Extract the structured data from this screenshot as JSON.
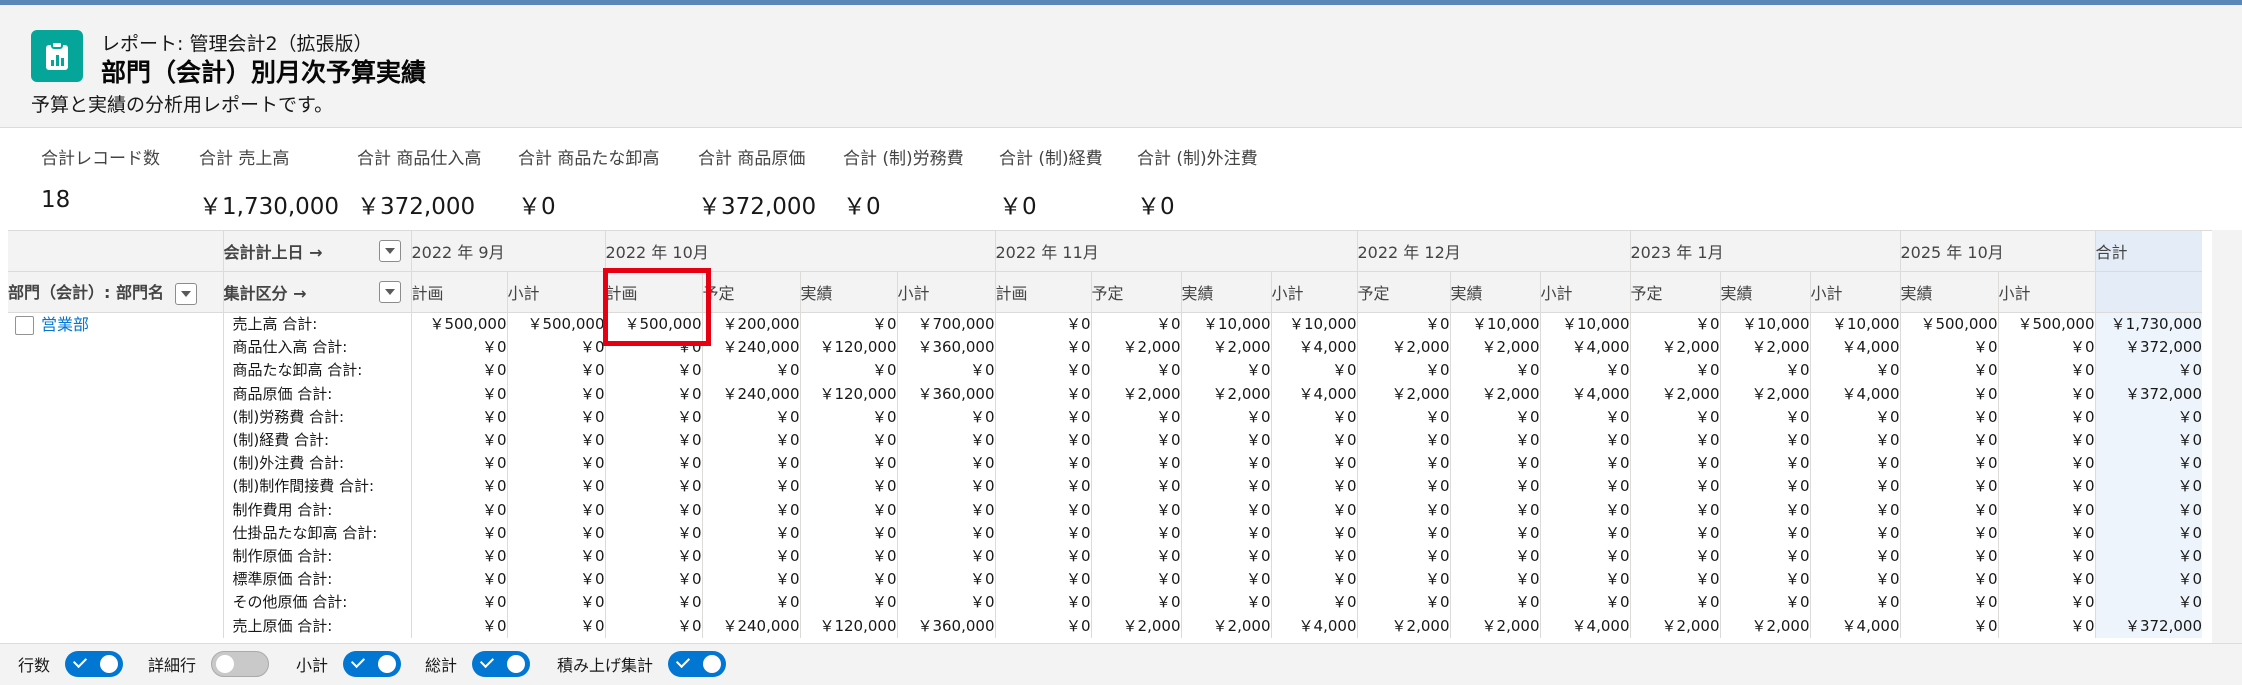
{
  "header": {
    "breadcrumb": "レポート: 管理会計2（拡張版）",
    "title": "部門（会計）別月次予算実績",
    "description": "予算と実績の分析用レポートです。"
  },
  "summary": [
    {
      "label": "合計レコード数",
      "value": "18"
    },
    {
      "label": "合計 売上高",
      "value": "￥1,730,000"
    },
    {
      "label": "合計 商品仕入高",
      "value": "￥372,000"
    },
    {
      "label": "合計 商品たな卸高",
      "value": "￥0"
    },
    {
      "label": "合計 商品原価",
      "value": "￥372,000"
    },
    {
      "label": "合計 (制)労務費",
      "value": "￥0"
    },
    {
      "label": "合計 (制)経費",
      "value": "￥0"
    },
    {
      "label": "合計 (制)外注費",
      "value": "￥0"
    }
  ],
  "table": {
    "row_header_date": "会計計上日 →",
    "row_header_dept": "部門（会計）: 部門名",
    "row_header_category": "集計区分 →",
    "months": [
      {
        "label": "2022 年 9月",
        "columns": [
          "計画",
          "小計"
        ]
      },
      {
        "label": "2022 年 10月",
        "columns": [
          "計画",
          "予定",
          "実績",
          "小計"
        ]
      },
      {
        "label": "2022 年 11月",
        "columns": [
          "計画",
          "予定",
          "実績",
          "小計"
        ]
      },
      {
        "label": "2022 年 12月",
        "columns": [
          "予定",
          "実績",
          "小計"
        ]
      },
      {
        "label": "2023 年 1月",
        "columns": [
          "予定",
          "実績",
          "小計"
        ]
      },
      {
        "label": "2025 年 10月",
        "columns": [
          "実績",
          "小計"
        ]
      }
    ],
    "total_label": "合計",
    "group": "営業部",
    "rows": [
      {
        "label": "売上高 合計:",
        "values": [
          "￥500,000",
          "￥500,000",
          "￥500,000",
          "￥200,000",
          "￥0",
          "￥700,000",
          "￥0",
          "￥0",
          "￥10,000",
          "￥10,000",
          "￥0",
          "￥10,000",
          "￥10,000",
          "￥0",
          "￥10,000",
          "￥10,000",
          "￥500,000",
          "￥500,000",
          "￥1,730,000"
        ]
      },
      {
        "label": "商品仕入高 合計:",
        "values": [
          "￥0",
          "￥0",
          "￥0",
          "￥240,000",
          "￥120,000",
          "￥360,000",
          "￥0",
          "￥2,000",
          "￥2,000",
          "￥4,000",
          "￥2,000",
          "￥2,000",
          "￥4,000",
          "￥2,000",
          "￥2,000",
          "￥4,000",
          "￥0",
          "￥0",
          "￥372,000"
        ]
      },
      {
        "label": "商品たな卸高 合計:",
        "values": [
          "￥0",
          "￥0",
          "￥0",
          "￥0",
          "￥0",
          "￥0",
          "￥0",
          "￥0",
          "￥0",
          "￥0",
          "￥0",
          "￥0",
          "￥0",
          "￥0",
          "￥0",
          "￥0",
          "￥0",
          "￥0",
          "￥0"
        ]
      },
      {
        "label": "商品原価 合計:",
        "values": [
          "￥0",
          "￥0",
          "￥0",
          "￥240,000",
          "￥120,000",
          "￥360,000",
          "￥0",
          "￥2,000",
          "￥2,000",
          "￥4,000",
          "￥2,000",
          "￥2,000",
          "￥4,000",
          "￥2,000",
          "￥2,000",
          "￥4,000",
          "￥0",
          "￥0",
          "￥372,000"
        ]
      },
      {
        "label": "(制)労務費 合計:",
        "values": [
          "￥0",
          "￥0",
          "￥0",
          "￥0",
          "￥0",
          "￥0",
          "￥0",
          "￥0",
          "￥0",
          "￥0",
          "￥0",
          "￥0",
          "￥0",
          "￥0",
          "￥0",
          "￥0",
          "￥0",
          "￥0",
          "￥0"
        ]
      },
      {
        "label": "(制)経費 合計:",
        "values": [
          "￥0",
          "￥0",
          "￥0",
          "￥0",
          "￥0",
          "￥0",
          "￥0",
          "￥0",
          "￥0",
          "￥0",
          "￥0",
          "￥0",
          "￥0",
          "￥0",
          "￥0",
          "￥0",
          "￥0",
          "￥0",
          "￥0"
        ]
      },
      {
        "label": "(制)外注費 合計:",
        "values": [
          "￥0",
          "￥0",
          "￥0",
          "￥0",
          "￥0",
          "￥0",
          "￥0",
          "￥0",
          "￥0",
          "￥0",
          "￥0",
          "￥0",
          "￥0",
          "￥0",
          "￥0",
          "￥0",
          "￥0",
          "￥0",
          "￥0"
        ]
      },
      {
        "label": "(制)制作間接費 合計:",
        "values": [
          "￥0",
          "￥0",
          "￥0",
          "￥0",
          "￥0",
          "￥0",
          "￥0",
          "￥0",
          "￥0",
          "￥0",
          "￥0",
          "￥0",
          "￥0",
          "￥0",
          "￥0",
          "￥0",
          "￥0",
          "￥0",
          "￥0"
        ]
      },
      {
        "label": "制作費用 合計:",
        "values": [
          "￥0",
          "￥0",
          "￥0",
          "￥0",
          "￥0",
          "￥0",
          "￥0",
          "￥0",
          "￥0",
          "￥0",
          "￥0",
          "￥0",
          "￥0",
          "￥0",
          "￥0",
          "￥0",
          "￥0",
          "￥0",
          "￥0"
        ]
      },
      {
        "label": "仕掛品たな卸高 合計:",
        "values": [
          "￥0",
          "￥0",
          "￥0",
          "￥0",
          "￥0",
          "￥0",
          "￥0",
          "￥0",
          "￥0",
          "￥0",
          "￥0",
          "￥0",
          "￥0",
          "￥0",
          "￥0",
          "￥0",
          "￥0",
          "￥0",
          "￥0"
        ]
      },
      {
        "label": "制作原価 合計:",
        "values": [
          "￥0",
          "￥0",
          "￥0",
          "￥0",
          "￥0",
          "￥0",
          "￥0",
          "￥0",
          "￥0",
          "￥0",
          "￥0",
          "￥0",
          "￥0",
          "￥0",
          "￥0",
          "￥0",
          "￥0",
          "￥0",
          "￥0"
        ]
      },
      {
        "label": "標準原価 合計:",
        "values": [
          "￥0",
          "￥0",
          "￥0",
          "￥0",
          "￥0",
          "￥0",
          "￥0",
          "￥0",
          "￥0",
          "￥0",
          "￥0",
          "￥0",
          "￥0",
          "￥0",
          "￥0",
          "￥0",
          "￥0",
          "￥0",
          "￥0"
        ]
      },
      {
        "label": "その他原価 合計:",
        "values": [
          "￥0",
          "￥0",
          "￥0",
          "￥0",
          "￥0",
          "￥0",
          "￥0",
          "￥0",
          "￥0",
          "￥0",
          "￥0",
          "￥0",
          "￥0",
          "￥0",
          "￥0",
          "￥0",
          "￥0",
          "￥0",
          "￥0"
        ]
      },
      {
        "label": "売上原価 合計:",
        "values": [
          "￥0",
          "￥0",
          "￥0",
          "￥240,000",
          "￥120,000",
          "￥360,000",
          "￥0",
          "￥2,000",
          "￥2,000",
          "￥4,000",
          "￥2,000",
          "￥2,000",
          "￥4,000",
          "￥2,000",
          "￥2,000",
          "￥4,000",
          "￥0",
          "￥0",
          "￥372,000"
        ]
      }
    ]
  },
  "footer": {
    "toggles": [
      {
        "label": "行数",
        "on": true
      },
      {
        "label": "詳細行",
        "on": false
      },
      {
        "label": "小計",
        "on": true
      },
      {
        "label": "総計",
        "on": true
      },
      {
        "label": "積み上げ集計",
        "on": true
      }
    ]
  },
  "colors": {
    "accent": "#0176d3",
    "icon_bg": "#06a59a",
    "highlight": "#e60012"
  }
}
